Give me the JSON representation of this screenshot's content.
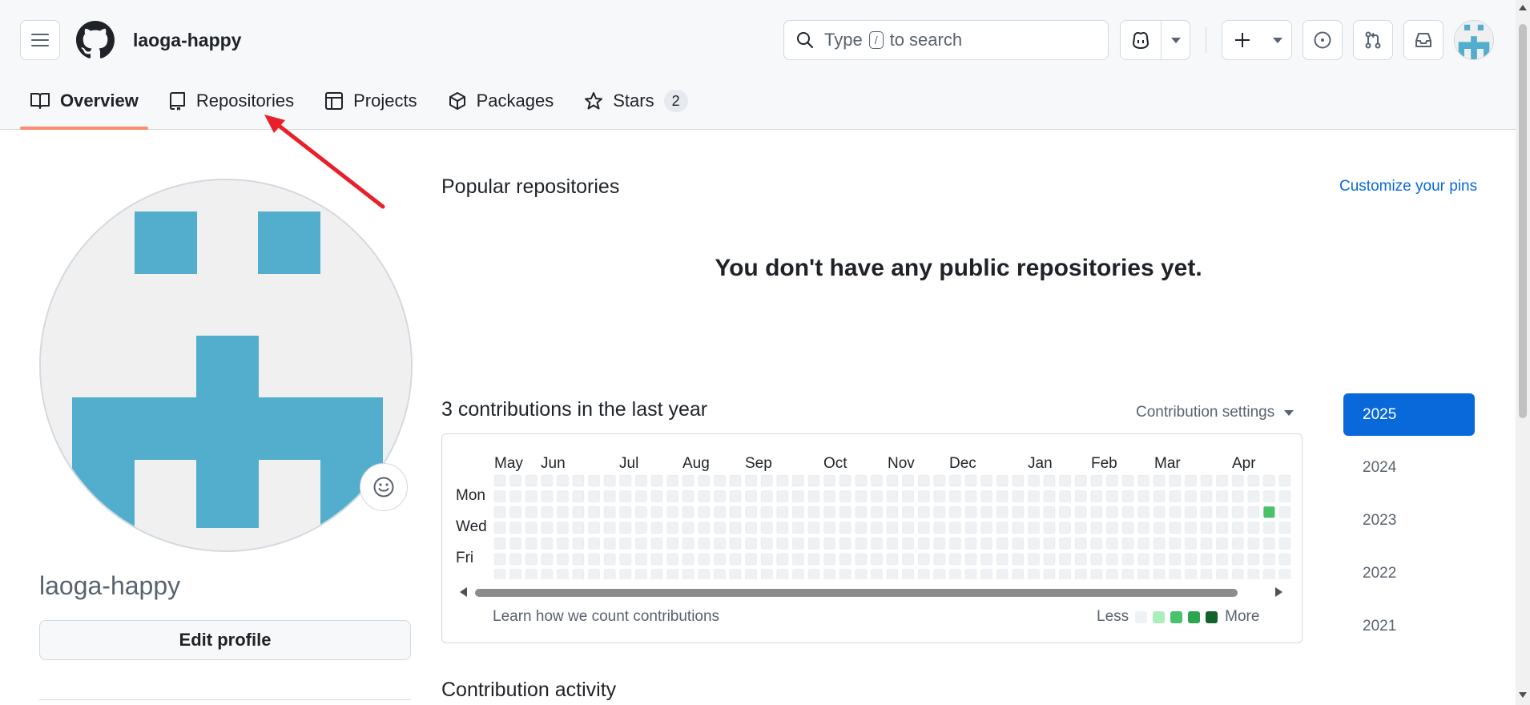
{
  "header": {
    "username": "laoga-happy",
    "search": {
      "prefix": "Type",
      "key": "/",
      "suffix": "to search"
    }
  },
  "tabs": [
    {
      "label": "Overview",
      "icon": "book-icon",
      "active": true
    },
    {
      "label": "Repositories",
      "icon": "repo-icon"
    },
    {
      "label": "Projects",
      "icon": "table-icon"
    },
    {
      "label": "Packages",
      "icon": "package-icon"
    },
    {
      "label": "Stars",
      "icon": "star-icon",
      "count": "2"
    }
  ],
  "profile": {
    "name": "laoga-happy",
    "edit_label": "Edit profile"
  },
  "popular": {
    "title": "Popular repositories",
    "customize": "Customize your pins",
    "empty": "You don't have any public repositories yet."
  },
  "contributions": {
    "title": "3 contributions in the last year",
    "settings": "Contribution settings",
    "months": [
      "May",
      "Jun",
      "Jul",
      "Aug",
      "Sep",
      "Oct",
      "Nov",
      "Dec",
      "Jan",
      "Feb",
      "Mar",
      "Apr"
    ],
    "days": [
      "Mon",
      "Wed",
      "Fri"
    ],
    "learn": "Learn how we count contributions",
    "legend_less": "Less",
    "legend_more": "More",
    "legend_colors": [
      "#eff2f5",
      "#aceebb",
      "#4ac26b",
      "#2da44e",
      "#116329"
    ],
    "active_cell": {
      "week": 49,
      "day": 2,
      "color": "#4ac26b"
    }
  },
  "years": [
    "2025",
    "2024",
    "2023",
    "2022",
    "2021"
  ],
  "activity": {
    "title": "Contribution activity"
  },
  "colors": {
    "accent": "#0969da",
    "tab_underline": "#fd8c73",
    "avatar": "#52aecc",
    "annotation_arrow": "#e8202a"
  }
}
